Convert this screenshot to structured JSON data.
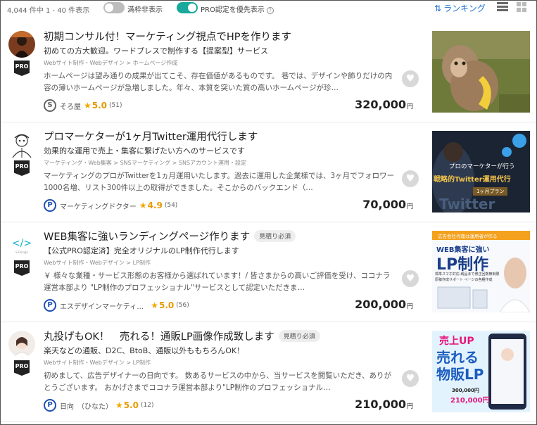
{
  "toolbar": {
    "count_text": "4,044 件中 1 - 40 件表示",
    "toggle_vacant_label": "満枠非表示",
    "toggle_pro_label": "PRO認定を優先表示",
    "help_glyph": "?",
    "ranking_label": "ランキング",
    "ranking_icon": "sort-arrows-icon"
  },
  "listings": [
    {
      "title": "初期コンサル付！マーケティング視点でHPを作ります",
      "estimate": "",
      "subtitle": "初めての方大歓迎。ワードプレスで制作する【提案型】サービス",
      "category": "Webサイト制作・Webデザイン > ホームページ作成",
      "description": "ホームページは望み通りの成果が出てこそ、存在価値があるものです。 巷では、デザインや飾りだけの内容の薄いホームページが急増しました。年々、本質を突いた質の高いホームページが珍…",
      "seller_badge": "S",
      "seller": "そろ屋",
      "rating": "5.0",
      "reviews": "(51)",
      "price": "320,000",
      "yen": "円",
      "pro": "PRO"
    },
    {
      "title": "プロマーケターが1ヶ月Twitter運用代行します",
      "estimate": "",
      "subtitle": "効果的な運用で売上・集客に繋げたい方へのサービスです",
      "category": "マーケティング・Web集客 > SNSマーケティング > SNSアカウント運用・設定",
      "description": "マーケティングのプロがTwitterを1ヵ月運用いたします。過去に運用した企業様では、3ヶ月でフォロワー1000名増、リスト300件以上の取得ができました。そこからのバックエンド（…",
      "seller_badge": "P",
      "seller": "マーケティングドクター",
      "rating": "4.9",
      "reviews": "(54)",
      "price": "70,000",
      "yen": "円",
      "pro": "PRO",
      "thumb_text": [
        "プロのマーケターが行う",
        "戦略的Twitter運用代行",
        "1ヶ月プラン",
        "Twitter"
      ]
    },
    {
      "title": "WEB集客に強いランディングページ作ります",
      "estimate": "見積り必須",
      "subtitle": "【公式PRO認定済】完全オリジナルのLP制作代行します",
      "category": "Webサイト制作・Webデザイン > LP制作",
      "description": "￥ 様々な業種・サービス形態のお客様から選ばれています！/ 皆さまからの高いご評価を受け、ココナラ運営本部より \"LP制作のプロフェッショナル\"サービスとして認定いただきま…",
      "seller_badge": "P",
      "seller": "エスデザインマーケティ…",
      "rating": "5.0",
      "reviews": "(56)",
      "price": "200,000",
      "yen": "円",
      "pro": "PRO",
      "thumb_text": [
        "広告会社代理は運用者が作る",
        "WEB集客に強い",
        "LP制作",
        "標準スマホ対応 納品まで修正回数無制限",
        "原稿作成サポート ページの各種作成"
      ]
    },
    {
      "title": "丸投げもOK！　売れる！通販LP画像作成致します",
      "estimate": "見積り必須",
      "subtitle": "楽天などの通販、D2C、BtoB、通販以外ももちろんOK！",
      "category": "Webサイト制作・Webデザイン > LP制作",
      "description": "初めまして、広告デザイナーの日向です。 数あるサービスの中から、当サービスを閲覧いただき、ありがとうございます。 おかげさまでココナラ運営本部より\"LP制作のプロフェッショナル…",
      "seller_badge": "P",
      "seller": "日向　（ひなた）",
      "rating": "5.0",
      "reviews": "(12)",
      "price": "210,000",
      "yen": "円",
      "pro": "PRO",
      "thumb_text": [
        "売上UP",
        "売れる",
        "物販LP",
        "300,000円",
        "210,000円"
      ]
    }
  ],
  "colors": {
    "accent_teal": "#1aa89c",
    "link_blue": "#1e6fd0",
    "star": "#f0a800"
  }
}
